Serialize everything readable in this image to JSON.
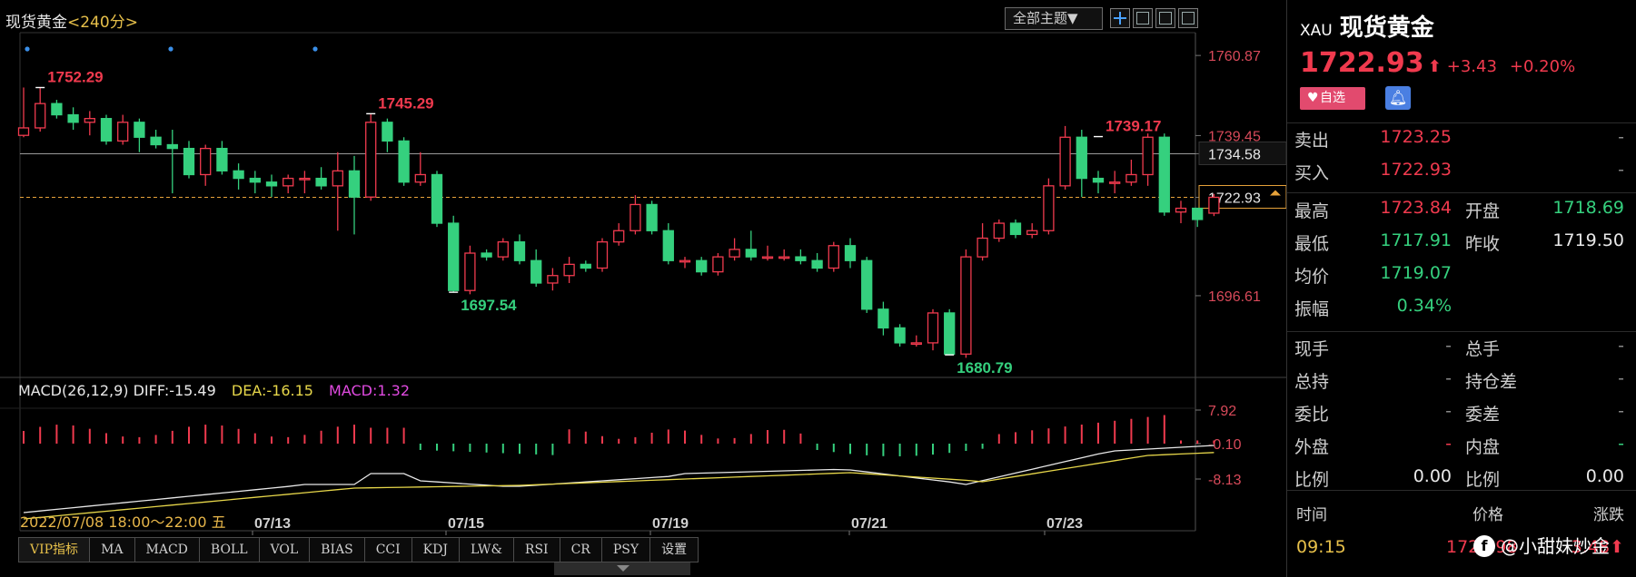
{
  "header": {
    "title": "现货黄金",
    "period": "<240分>",
    "theme_button": "全部主题▼"
  },
  "price_axis": [
    "1760.87",
    "1739.45",
    "1734.58",
    "1722.93",
    "1696.61"
  ],
  "annotations": {
    "high1": "1752.29",
    "high2": "1745.29",
    "low1": "1697.54",
    "high3": "1739.17",
    "low2": "1680.79"
  },
  "macd_legend": {
    "name": "MACD(26,12,9)",
    "diff": "DIFF:-15.49",
    "dea": "DEA:-16.15",
    "macd": "MACD:1.32"
  },
  "macd_axis": [
    "7.92",
    "-0.10",
    "-8.13"
  ],
  "date_axis": {
    "cursor_label": "2022/07/08 18:00～22:00 五",
    "labels": [
      "07/13",
      "07/15",
      "07/19",
      "07/21",
      "07/23"
    ]
  },
  "tabs": [
    "VIP指标",
    "MA",
    "MACD",
    "BOLL",
    "VOL",
    "BIAS",
    "CCI",
    "KDJ",
    "LW&",
    "RSI",
    "CR",
    "PSY",
    "设置"
  ],
  "colors": {
    "up": "#f03a4e",
    "down": "#35d07e",
    "ma_white": "#e8e8e8",
    "ma_yellow": "#e7d74a",
    "dashed_line": "#e7a23a"
  },
  "chart_data": {
    "type": "candlestick",
    "ylim": [
      1675,
      1766
    ],
    "reference_lines": {
      "resistance": 1734.58,
      "last_price": 1722.93
    },
    "candles": [
      [
        1739.5,
        1741.5,
        1752.3,
        1739
      ],
      [
        1741.5,
        1748,
        1752.29,
        1740.5
      ],
      [
        1748,
        1745,
        1749,
        1744
      ],
      [
        1745,
        1743,
        1747,
        1741
      ],
      [
        1743,
        1744,
        1746,
        1739.5
      ],
      [
        1744,
        1738,
        1745,
        1737
      ],
      [
        1738,
        1743,
        1745,
        1737
      ],
      [
        1743,
        1739,
        1744,
        1735
      ],
      [
        1739,
        1737,
        1741,
        1736
      ],
      [
        1737,
        1736,
        1741,
        1724
      ],
      [
        1736,
        1729,
        1738,
        1728
      ],
      [
        1729,
        1736,
        1737,
        1726
      ],
      [
        1736,
        1730,
        1738,
        1729
      ],
      [
        1730,
        1728,
        1732,
        1725
      ],
      [
        1728,
        1727,
        1730,
        1724
      ],
      [
        1727,
        1726,
        1729,
        1723
      ],
      [
        1726,
        1728,
        1729,
        1724
      ],
      [
        1728,
        1728,
        1730,
        1724
      ],
      [
        1728,
        1726,
        1731,
        1725
      ],
      [
        1726,
        1730,
        1735,
        1714
      ],
      [
        1730,
        1723,
        1734,
        1713
      ],
      [
        1723,
        1743,
        1745.29,
        1722
      ],
      [
        1743,
        1738,
        1744,
        1735
      ],
      [
        1738,
        1727,
        1739,
        1726
      ],
      [
        1727,
        1729,
        1735,
        1726
      ],
      [
        1729,
        1716,
        1730,
        1715
      ],
      [
        1716,
        1698,
        1718,
        1697.54
      ],
      [
        1698,
        1708,
        1710,
        1697
      ],
      [
        1708,
        1707,
        1709,
        1706
      ],
      [
        1707,
        1711,
        1712,
        1706
      ],
      [
        1711,
        1706,
        1713,
        1705
      ],
      [
        1706,
        1700,
        1709,
        1699
      ],
      [
        1700,
        1702,
        1704,
        1698
      ],
      [
        1702,
        1705,
        1707,
        1700
      ],
      [
        1705,
        1704,
        1706,
        1703
      ],
      [
        1704,
        1711,
        1712,
        1703
      ],
      [
        1711,
        1714,
        1716,
        1710
      ],
      [
        1714,
        1721,
        1723.5,
        1713
      ],
      [
        1721,
        1714,
        1722,
        1713
      ],
      [
        1714,
        1706,
        1716,
        1705
      ],
      [
        1706,
        1706,
        1707,
        1704
      ],
      [
        1706,
        1703,
        1707,
        1702
      ],
      [
        1703,
        1707,
        1708,
        1702
      ],
      [
        1707,
        1709,
        1712,
        1706
      ],
      [
        1709,
        1707,
        1714,
        1706
      ],
      [
        1707,
        1707,
        1710,
        1706
      ],
      [
        1707,
        1707,
        1709,
        1706
      ],
      [
        1707,
        1706,
        1709,
        1705
      ],
      [
        1706,
        1704,
        1708,
        1703
      ],
      [
        1704,
        1710,
        1711,
        1703
      ],
      [
        1710,
        1706,
        1712,
        1704
      ],
      [
        1706,
        1693,
        1707,
        1692
      ],
      [
        1693,
        1688,
        1695,
        1686
      ],
      [
        1688,
        1684,
        1689,
        1683
      ],
      [
        1684,
        1684,
        1686,
        1683
      ],
      [
        1684,
        1692,
        1693,
        1682
      ],
      [
        1692,
        1681,
        1693,
        1680.79
      ],
      [
        1681,
        1707,
        1709,
        1680
      ],
      [
        1707,
        1712,
        1716,
        1706
      ],
      [
        1712,
        1716,
        1717,
        1711
      ],
      [
        1716,
        1713,
        1717,
        1712
      ],
      [
        1713,
        1714,
        1716,
        1712
      ],
      [
        1714,
        1726,
        1728,
        1713
      ],
      [
        1726,
        1739,
        1742,
        1725
      ],
      [
        1739,
        1728,
        1741,
        1723
      ],
      [
        1728,
        1727,
        1730,
        1724
      ],
      [
        1727,
        1727,
        1730,
        1724
      ],
      [
        1727,
        1729,
        1733,
        1726
      ],
      [
        1729,
        1739,
        1740,
        1726
      ],
      [
        1739,
        1719,
        1740,
        1718
      ],
      [
        1719,
        1720,
        1722,
        1716
      ],
      [
        1720,
        1717,
        1720,
        1715
      ],
      [
        1718.69,
        1722.93,
        1723.84,
        1717.91
      ]
    ]
  },
  "quote": {
    "code": "XAU",
    "name": "现货黄金",
    "price": "1722.93",
    "arrow": "⬆",
    "change": "+3.43",
    "change_pct": "+0.20%",
    "fav_label": "自选",
    "rows": [
      {
        "k1": "卖出",
        "v1": "1723.25",
        "v1c": "red",
        "k2": "",
        "v2": "-",
        "v2c": "grey"
      },
      {
        "k1": "买入",
        "v1": "1722.93",
        "v1c": "red",
        "k2": "",
        "v2": "-",
        "v2c": "grey"
      },
      {
        "k1": "最高",
        "v1": "1723.84",
        "v1c": "red",
        "k2": "开盘",
        "v2": "1718.69",
        "v2c": "green"
      },
      {
        "k1": "最低",
        "v1": "1717.91",
        "v1c": "green",
        "k2": "昨收",
        "v2": "1719.50",
        "v2c": "white"
      },
      {
        "k1": "均价",
        "v1": "1719.07",
        "v1c": "green",
        "k2": "",
        "v2": "",
        "v2c": "white"
      },
      {
        "k1": "振幅",
        "v1": "0.34%",
        "v1c": "green",
        "k2": "",
        "v2": "",
        "v2c": "white"
      },
      {
        "k1": "现手",
        "v1": "-",
        "v1c": "grey",
        "k2": "总手",
        "v2": "-",
        "v2c": "grey"
      },
      {
        "k1": "总持",
        "v1": "-",
        "v1c": "grey",
        "k2": "持仓差",
        "v2": "-",
        "v2c": "grey"
      },
      {
        "k1": "委比",
        "v1": "-",
        "v1c": "grey",
        "k2": "委差",
        "v2": "-",
        "v2c": "grey"
      },
      {
        "k1": "外盘",
        "v1": "-",
        "v1c": "red",
        "k2": "内盘",
        "v2": "-",
        "v2c": "green"
      },
      {
        "k1": "比例",
        "v1": "0.00",
        "v1c": "white",
        "k2": "比例",
        "v2": "0.00",
        "v2c": "white"
      }
    ],
    "ticks_header": {
      "time": "时间",
      "price": "价格",
      "change": "涨跌"
    },
    "tick": {
      "time": "09:15",
      "price": "1722.98",
      "change": "3.48⬆"
    }
  },
  "watermark": {
    "logo": "f",
    "text": "@小甜妹炒金"
  }
}
